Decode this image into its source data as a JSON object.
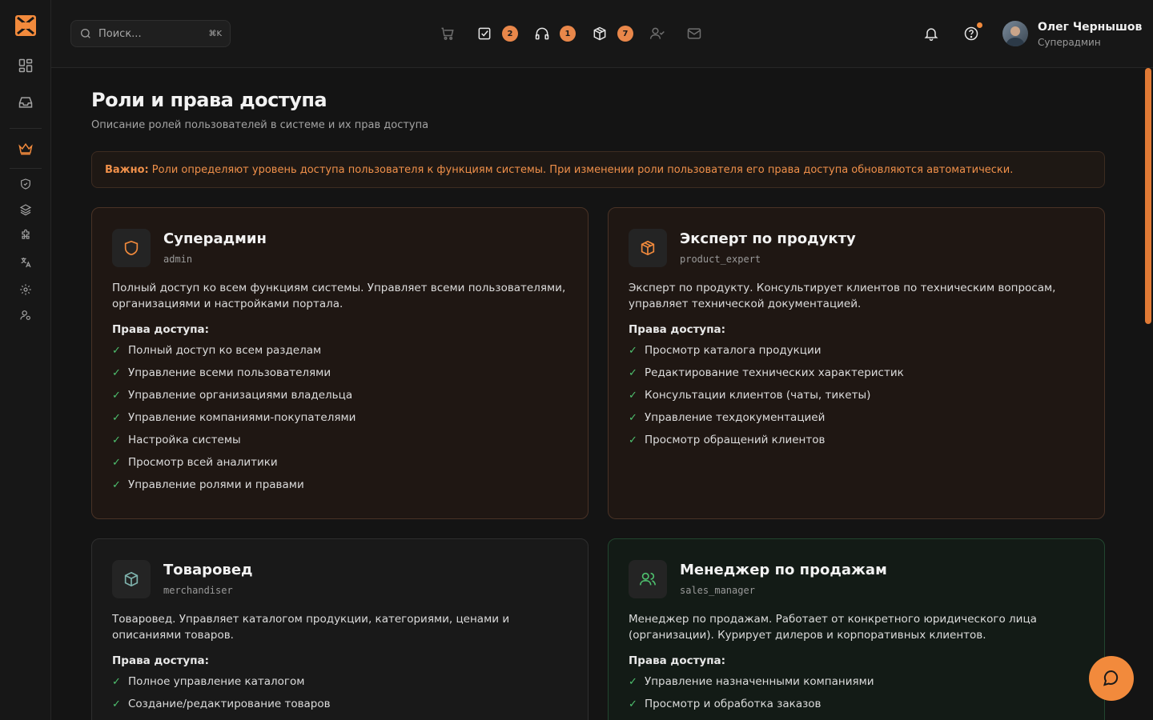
{
  "header": {
    "search_placeholder": "Поиск...",
    "search_shortcut": "⌘K",
    "badges": {
      "tasks": "2",
      "support": "1",
      "products": "7"
    },
    "user": {
      "name": "Олег Чернышов",
      "role": "Суперадмин"
    }
  },
  "page": {
    "title": "Роли и права доступа",
    "subtitle": "Описание ролей пользователей в системе и их прав доступа",
    "notice_label": "Важно:",
    "notice_text": "Роли определяют уровень доступа пользователя к функциям системы. При изменении роли пользователя его права доступа обновляются автоматически."
  },
  "accent_color": "#f28a3c",
  "roles": [
    {
      "title": "Суперадмин",
      "code": "admin",
      "icon": "shield-icon",
      "description": "Полный доступ ко всем функциям системы. Управляет всеми пользователями, организациями и настройками портала.",
      "permissions_label": "Права доступа:",
      "permissions": [
        "Полный доступ ко всем разделам",
        "Управление всеми пользователями",
        "Управление организациями владельца",
        "Управление компаниями-покупателями",
        "Настройка системы",
        "Просмотр всей аналитики",
        "Управление ролями и правами"
      ]
    },
    {
      "title": "Эксперт по продукту",
      "code": "product_expert",
      "icon": "package-icon",
      "description": "Эксперт по продукту. Консультирует клиентов по техническим вопросам, управляет технической документацией.",
      "permissions_label": "Права доступа:",
      "permissions": [
        "Просмотр каталога продукции",
        "Редактирование технических характеристик",
        "Консультации клиентов (чаты, тикеты)",
        "Управление техдокументацией",
        "Просмотр обращений клиентов"
      ]
    },
    {
      "title": "Товаровед",
      "code": "merchandiser",
      "icon": "box-icon",
      "description": "Товаровед. Управляет каталогом продукции, категориями, ценами и описаниями товаров.",
      "permissions_label": "Права доступа:",
      "permissions": [
        "Полное управление каталогом",
        "Создание/редактирование товаров"
      ]
    },
    {
      "title": "Менеджер по продажам",
      "code": "sales_manager",
      "icon": "users-icon",
      "description": "Менеджер по продажам. Работает от конкретного юридического лица (организации). Курирует дилеров и корпоративных клиентов.",
      "permissions_label": "Права доступа:",
      "permissions": [
        "Управление назначенными компаниями",
        "Просмотр и обработка заказов"
      ]
    }
  ]
}
